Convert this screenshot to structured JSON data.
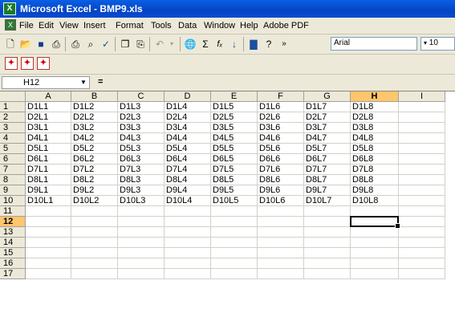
{
  "window": {
    "title": "Microsoft Excel - BMP9.xls",
    "app_icon": "excel-icon"
  },
  "menubar": {
    "items": [
      "File",
      "Edit",
      "View",
      "Insert",
      "Format",
      "Tools",
      "Data",
      "Window",
      "Help",
      "Adobe PDF"
    ]
  },
  "toolbar": {
    "icons": [
      "new-icon",
      "open-icon",
      "save-icon",
      "permission-icon",
      "print-icon",
      "print-preview-icon",
      "spelling-icon",
      "copy-icon",
      "paste-icon",
      "undo-icon",
      "hyperlink-icon",
      "autosum-icon",
      "function-icon",
      "sort-ascending-icon",
      "chart-wizard-icon",
      "help-icon",
      "toolbar-options-icon"
    ],
    "font": "Arial",
    "font_size": "10"
  },
  "pdf_toolbar": {
    "icons": [
      "convert-to-pdf-icon",
      "convert-and-email-icon",
      "convert-and-review-icon"
    ]
  },
  "formula_bar": {
    "name_box": "H12",
    "equals": "="
  },
  "sheet": {
    "columns": [
      "",
      "A",
      "B",
      "C",
      "D",
      "E",
      "F",
      "G",
      "H",
      "I"
    ],
    "selected_column": "H",
    "selected_row": "12",
    "rows": [
      {
        "num": "1",
        "cells": [
          "D1L1",
          "D1L2",
          "D1L3",
          "D1L4",
          "D1L5",
          "D1L6",
          "D1L7",
          "D1L8",
          ""
        ]
      },
      {
        "num": "2",
        "cells": [
          "D2L1",
          "D2L2",
          "D2L3",
          "D2L4",
          "D2L5",
          "D2L6",
          "D2L7",
          "D2L8",
          ""
        ]
      },
      {
        "num": "3",
        "cells": [
          "D3L1",
          "D3L2",
          "D3L3",
          "D3L4",
          "D3L5",
          "D3L6",
          "D3L7",
          "D3L8",
          ""
        ]
      },
      {
        "num": "4",
        "cells": [
          "D4L1",
          "D4L2",
          "D4L3",
          "D4L4",
          "D4L5",
          "D4L6",
          "D4L7",
          "D4L8",
          ""
        ]
      },
      {
        "num": "5",
        "cells": [
          "D5L1",
          "D5L2",
          "D5L3",
          "D5L4",
          "D5L5",
          "D5L6",
          "D5L7",
          "D5L8",
          ""
        ]
      },
      {
        "num": "6",
        "cells": [
          "D6L1",
          "D6L2",
          "D6L3",
          "D6L4",
          "D6L5",
          "D6L6",
          "D6L7",
          "D6L8",
          ""
        ]
      },
      {
        "num": "7",
        "cells": [
          "D7L1",
          "D7L2",
          "D7L3",
          "D7L4",
          "D7L5",
          "D7L6",
          "D7L7",
          "D7L8",
          ""
        ]
      },
      {
        "num": "8",
        "cells": [
          "D8L1",
          "D8L2",
          "D8L3",
          "D8L4",
          "D8L5",
          "D8L6",
          "D8L7",
          "D8L8",
          ""
        ]
      },
      {
        "num": "9",
        "cells": [
          "D9L1",
          "D9L2",
          "D9L3",
          "D9L4",
          "D9L5",
          "D9L6",
          "D9L7",
          "D9L8",
          ""
        ]
      },
      {
        "num": "10",
        "cells": [
          "D10L1",
          "D10L2",
          "D10L3",
          "D10L4",
          "D10L5",
          "D10L6",
          "D10L7",
          "D10L8",
          ""
        ]
      },
      {
        "num": "11",
        "cells": [
          "",
          "",
          "",
          "",
          "",
          "",
          "",
          "",
          ""
        ]
      },
      {
        "num": "12",
        "cells": [
          "",
          "",
          "",
          "",
          "",
          "",
          "",
          "",
          ""
        ]
      },
      {
        "num": "13",
        "cells": [
          "",
          "",
          "",
          "",
          "",
          "",
          "",
          "",
          ""
        ]
      },
      {
        "num": "14",
        "cells": [
          "",
          "",
          "",
          "",
          "",
          "",
          "",
          "",
          ""
        ]
      },
      {
        "num": "15",
        "cells": [
          "",
          "",
          "",
          "",
          "",
          "",
          "",
          "",
          ""
        ]
      },
      {
        "num": "16",
        "cells": [
          "",
          "",
          "",
          "",
          "",
          "",
          "",
          "",
          ""
        ]
      },
      {
        "num": "17",
        "cells": [
          "",
          "",
          "",
          "",
          "",
          "",
          "",
          "",
          ""
        ]
      }
    ]
  }
}
